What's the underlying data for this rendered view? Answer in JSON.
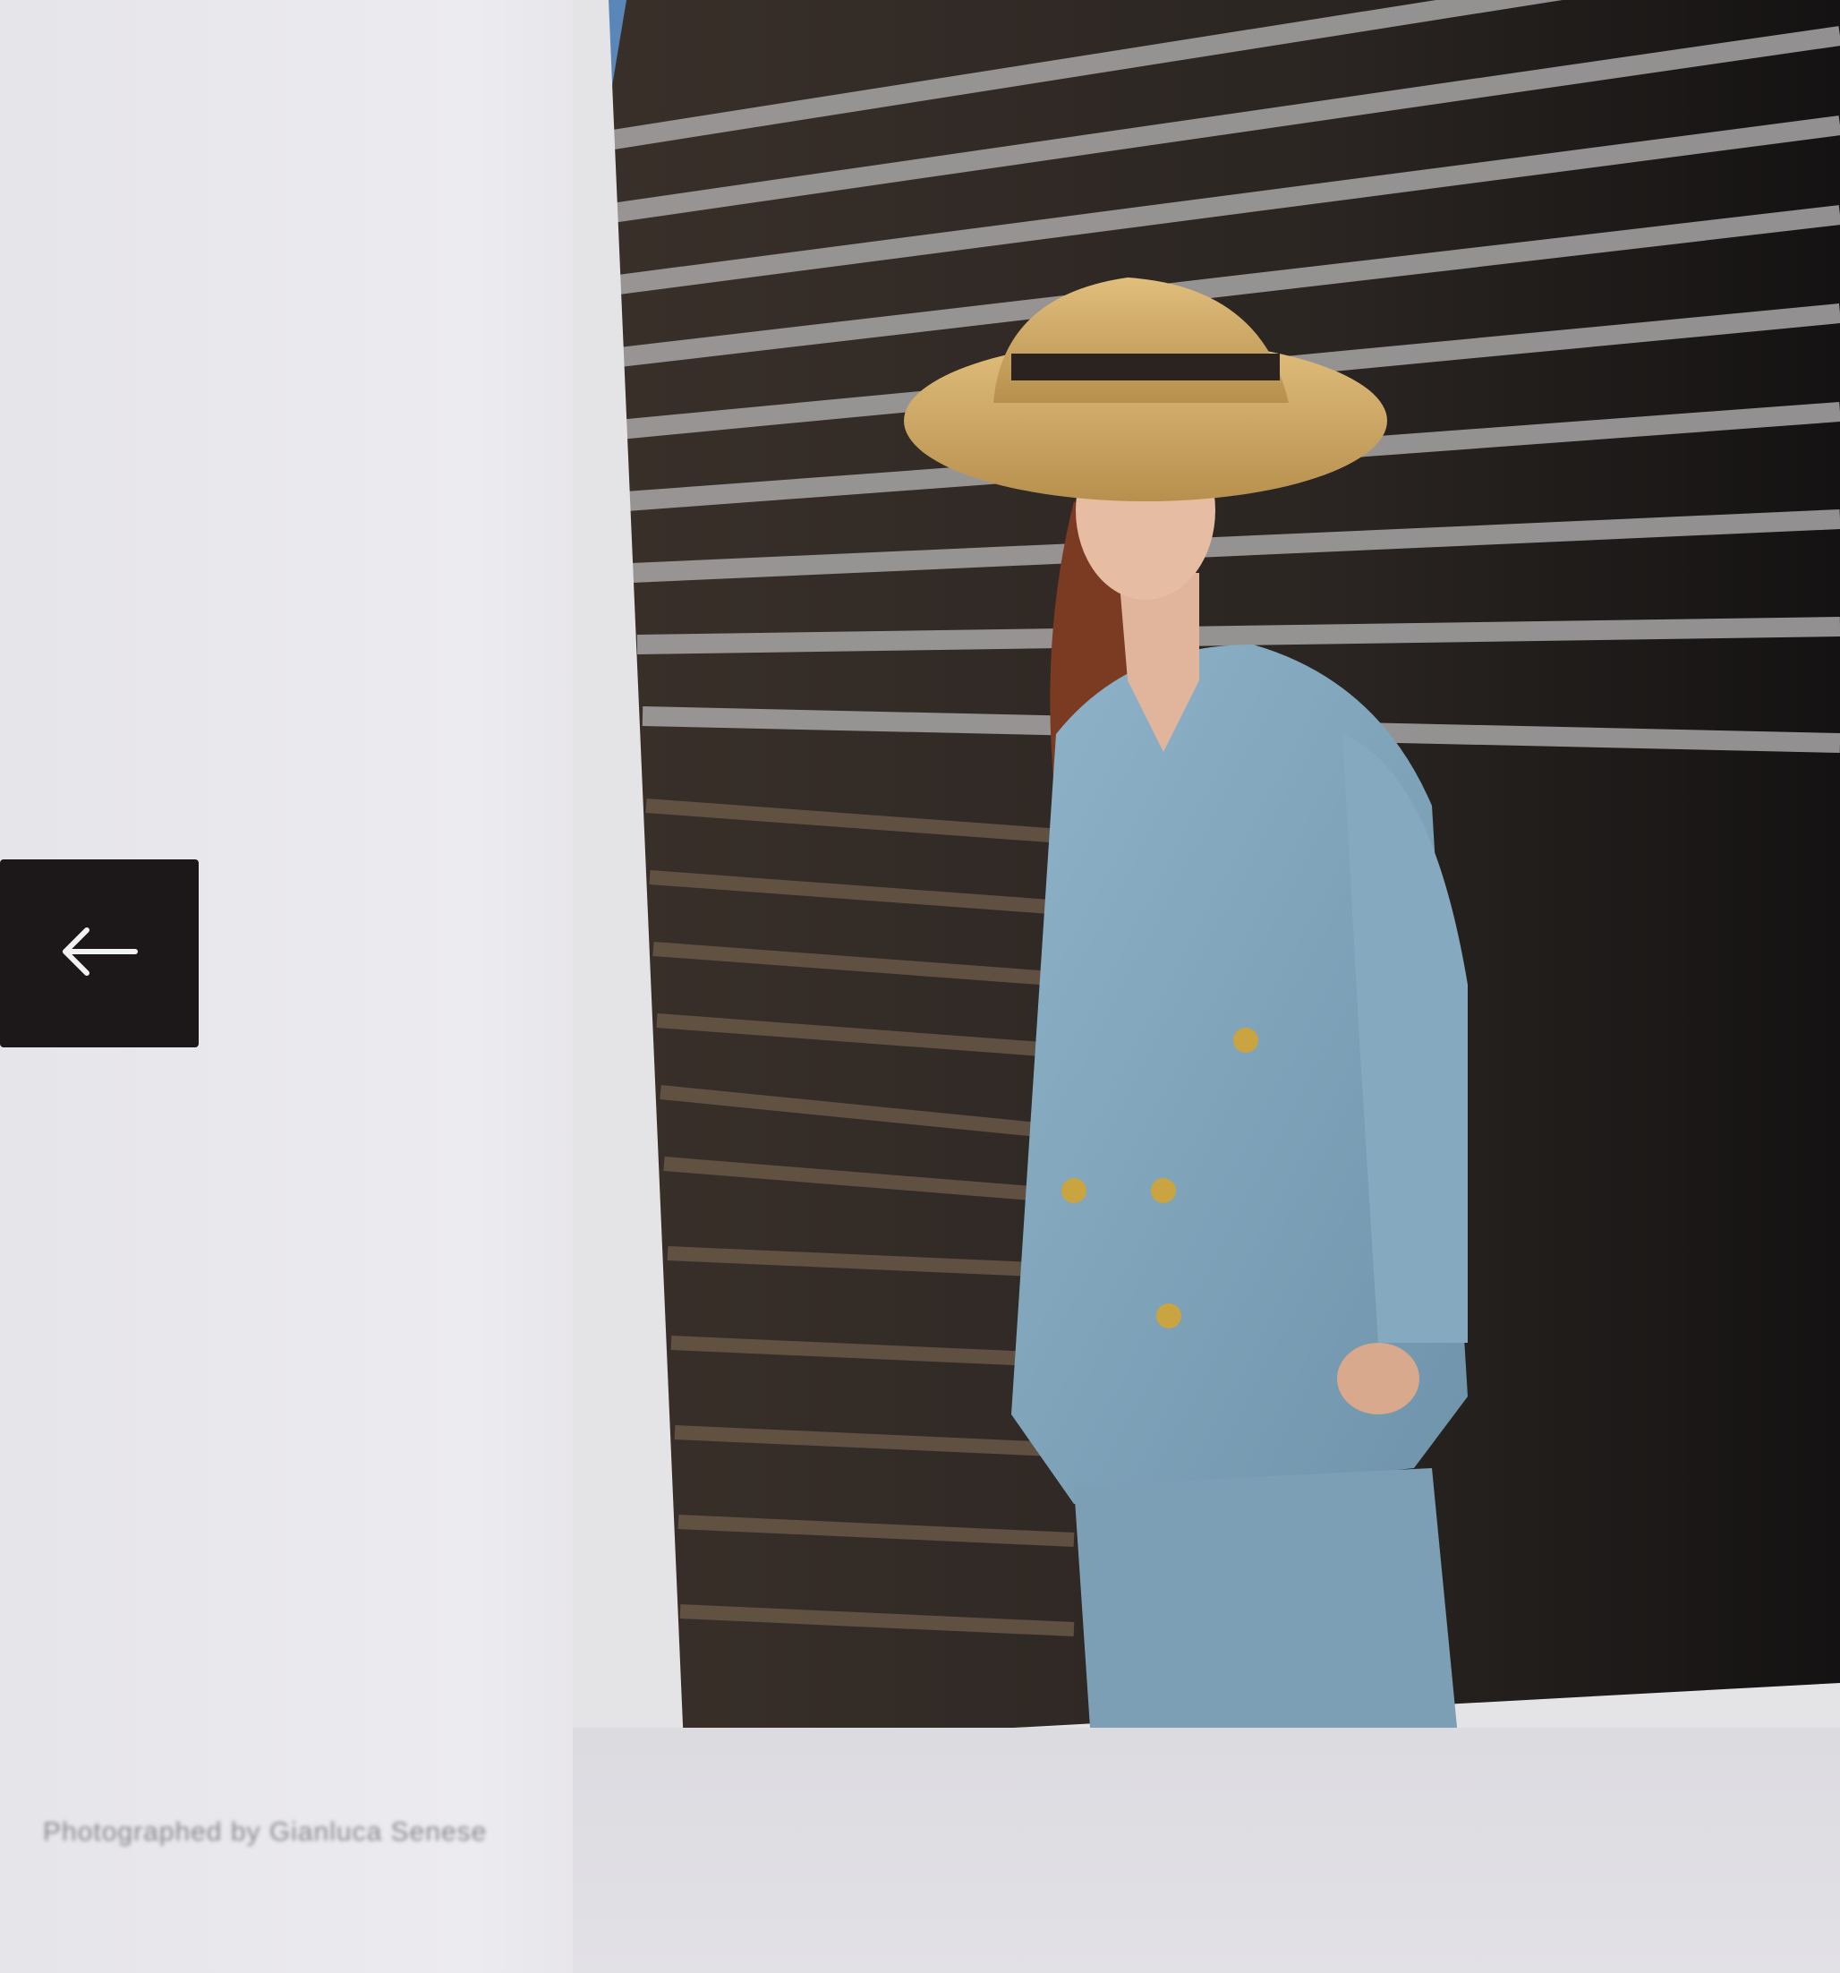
{
  "gallery": {
    "nav": {
      "previous_icon": "arrow-left-icon"
    },
    "photo": {
      "subject": "street-style photo"
    },
    "caption": "Photographed by Gianluca Senese"
  },
  "colors": {
    "button_bg": "#1c1718",
    "caption_text": "#8a898e",
    "page_bg": "#e4e3e6"
  }
}
